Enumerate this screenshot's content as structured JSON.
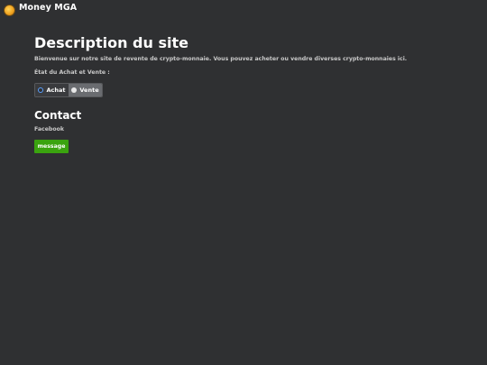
{
  "app": {
    "title": "Money MGA"
  },
  "section1": {
    "heading": "Description du site",
    "description": "Bienvenue sur notre site de revente de crypto-monnaie. Vous pouvez acheter ou vendre diverses crypto-monnaies ici.",
    "state_label": "État du Achat et Vente :",
    "toggle": [
      {
        "label": "Achat",
        "selected": true
      },
      {
        "label": "Vente",
        "selected": false
      }
    ]
  },
  "section2": {
    "heading": "Contact",
    "subtitle": "Facebook",
    "button_label": "message"
  },
  "colors": {
    "background": "#2f3032",
    "accent_button": "#3aa30f",
    "radio_selected": "#5aa0ff"
  },
  "icons": {
    "logo": "coin-logo-icon"
  }
}
